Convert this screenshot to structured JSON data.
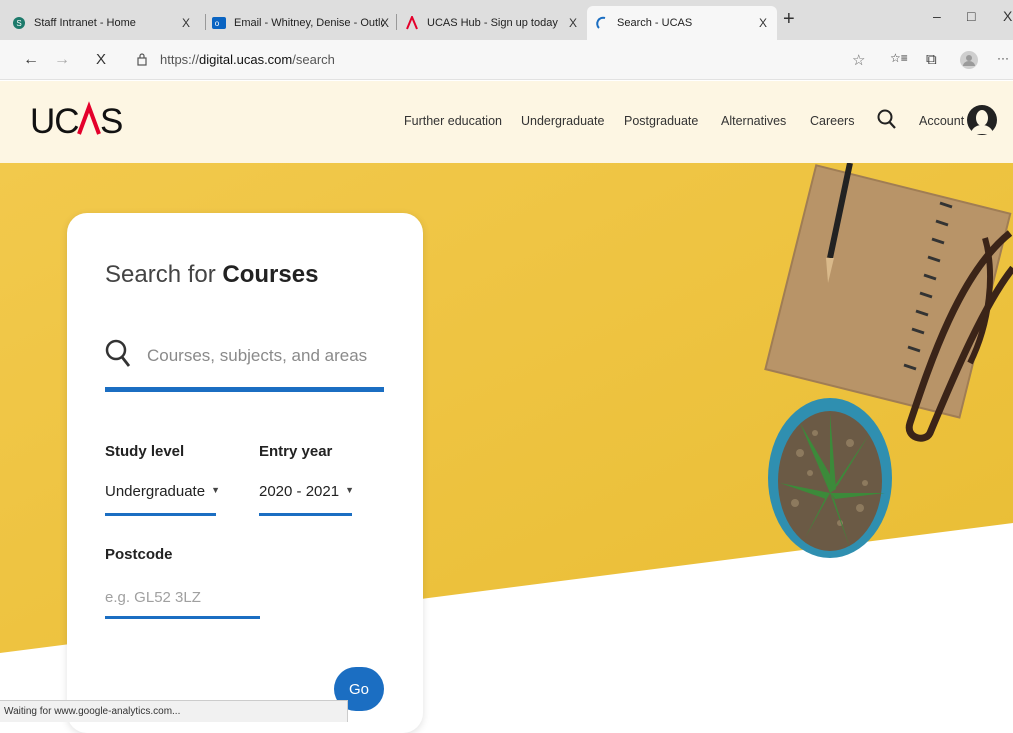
{
  "browser": {
    "tabs": [
      {
        "title": "Staff Intranet - Home",
        "close": "X"
      },
      {
        "title": "Email - Whitney, Denise - Outloo",
        "close": "X"
      },
      {
        "title": "UCAS Hub - Sign up today",
        "close": "X"
      },
      {
        "title": "Search - UCAS",
        "close": "X",
        "active": true
      }
    ],
    "new_tab": "+",
    "window": {
      "minimize": "–",
      "restore": "□",
      "close": "X"
    },
    "nav": {
      "back": "←",
      "forward": "→",
      "stop": "X"
    },
    "url_prefix": "https://",
    "url_host": "digital.ucas.com",
    "url_path": "/search",
    "toolbar": {
      "favorite": "☆",
      "favorites": "☆≡",
      "collections": "⧉",
      "more": "···"
    },
    "status": "Waiting for www.google-analytics.com..."
  },
  "site": {
    "logo_text": "UCAS",
    "nav": [
      "Further education",
      "Undergraduate",
      "Postgraduate",
      "Alternatives",
      "Careers"
    ],
    "account_label": "Account",
    "accent_color": "#1b6ec2",
    "logo_accent_color": "#e4002b"
  },
  "search": {
    "heading_prefix": "Search for",
    "heading_bold": "Courses",
    "placeholder": "Courses, subjects, and areas",
    "study_level": {
      "label": "Study level",
      "value": "Undergraduate"
    },
    "entry_year": {
      "label": "Entry year",
      "value": "2020 - 2021"
    },
    "postcode": {
      "label": "Postcode",
      "placeholder": "e.g. GL52 3LZ"
    },
    "go_label": "Go"
  }
}
